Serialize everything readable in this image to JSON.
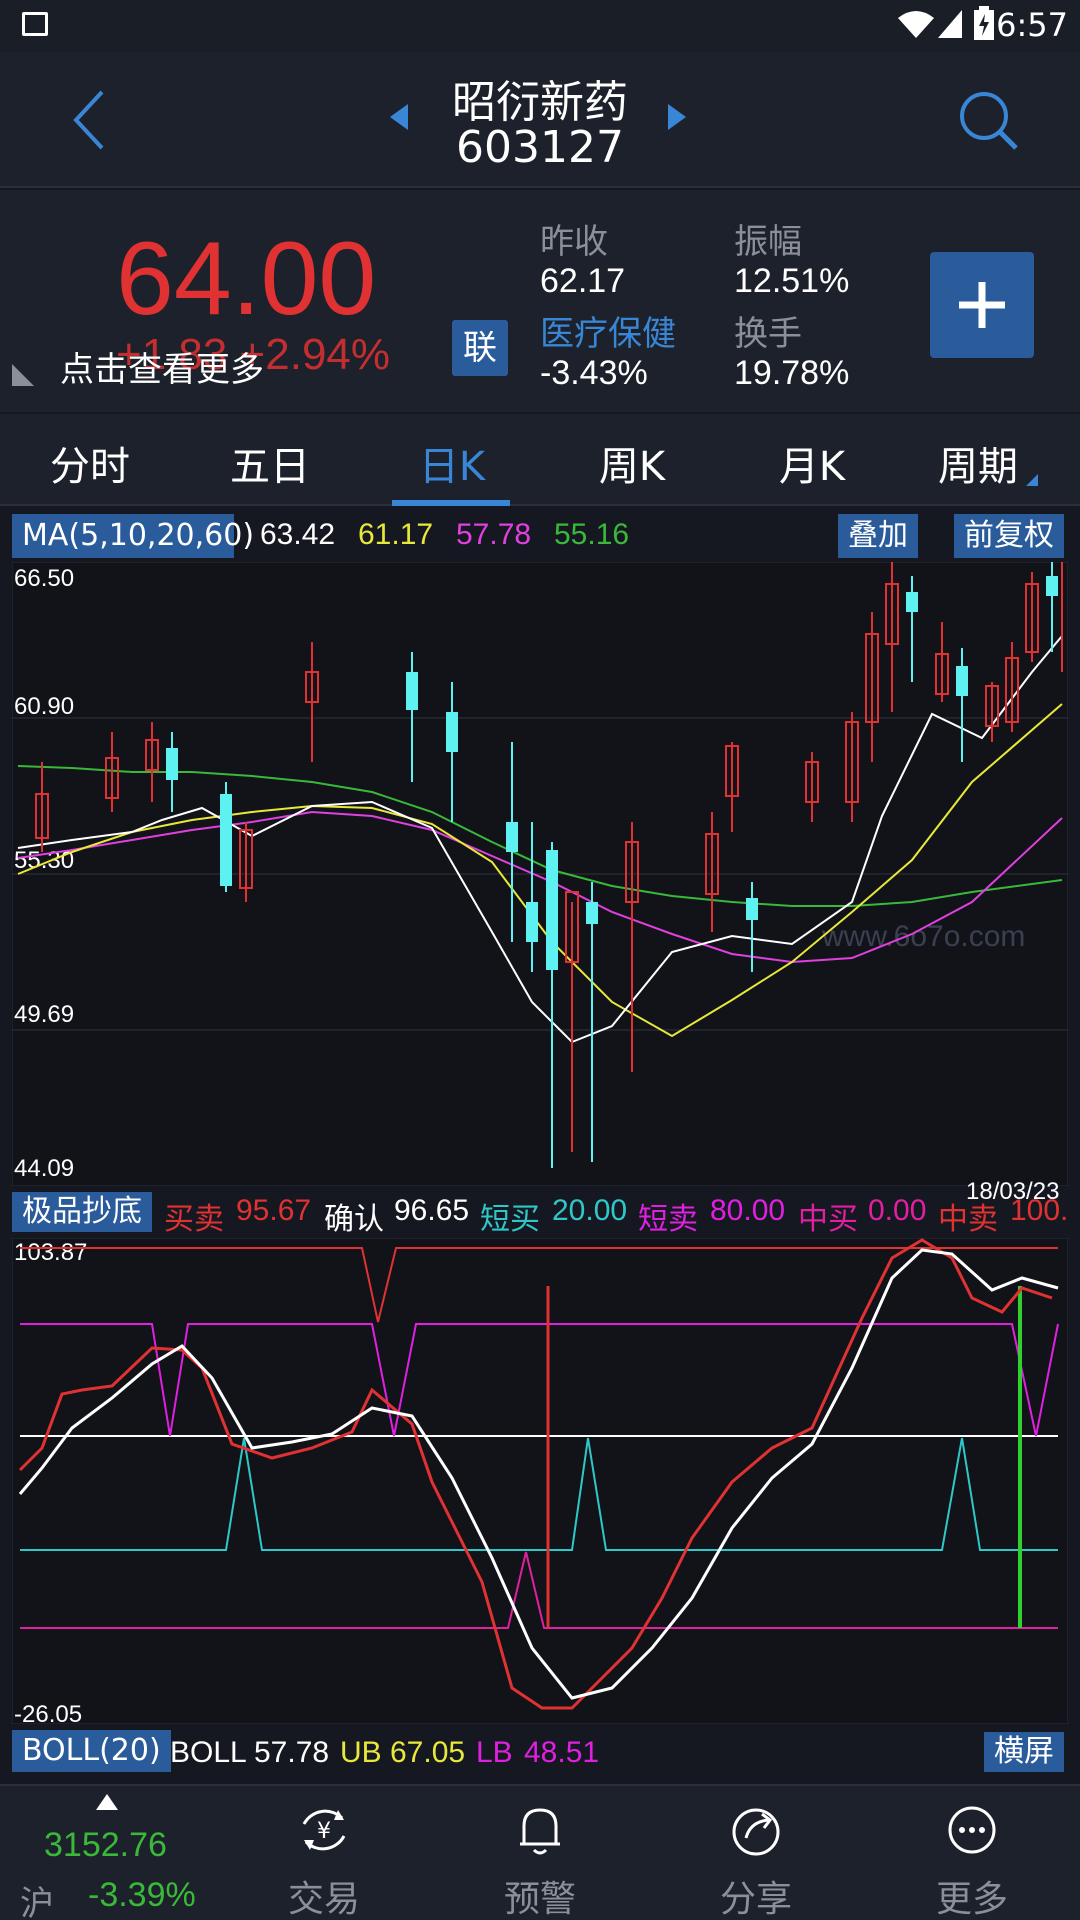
{
  "status": {
    "time": "6:57"
  },
  "header": {
    "stock_name": "昭衍新药",
    "stock_code": "603127"
  },
  "quote": {
    "price": "64.00",
    "change": "+1.83  +2.94%",
    "tooltip": "点击查看更多",
    "lian_label": "联",
    "prev_close_label": "昨收",
    "prev_close": "62.17",
    "amplitude_label": "振幅",
    "amplitude": "12.51%",
    "sector_label": "医疗保健",
    "sector_change": "-3.43%",
    "turnover_label": "换手",
    "turnover": "19.78%",
    "colors": {
      "up": "#e03232",
      "down": "#5ef1f1",
      "accent": "#3a86d6"
    }
  },
  "tabs": [
    "分时",
    "五日",
    "日K",
    "周K",
    "月K",
    "周期"
  ],
  "active_tab": "日K",
  "ma_legend": {
    "label": "MA(5,10,20,60)",
    "ma5": "63.42",
    "ma10": "61.17",
    "ma20": "57.78",
    "ma60": "55.16",
    "overlay_btn": "叠加",
    "adjust_btn": "前复权"
  },
  "kline_axis": {
    "y1": "66.50",
    "y2": "60.90",
    "y3": "55.30",
    "y4": "49.69",
    "y5": "44.09"
  },
  "watermark": "www.6o7o.com",
  "indicator": {
    "label": "极品抄底",
    "buy_sell_label": "买卖",
    "buy_sell": "95.67",
    "confirm_label": "确认",
    "confirm": "96.65",
    "short_buy_label": "短买",
    "short_buy": "20.00",
    "short_sell_label": "短卖",
    "short_sell": "80.00",
    "mid_buy_label": "中买",
    "mid_buy": "0.00",
    "mid_sell_label": "中卖",
    "mid_sell": "100.",
    "date": "18/03/23",
    "y_top": "103.87",
    "y_bottom": "-26.05"
  },
  "boll": {
    "label": "BOLL(20)",
    "boll_label": "BOLL",
    "boll": "57.78",
    "ub_label": "UB",
    "ub": "67.05",
    "lb_label": "LB",
    "lb": "48.51",
    "landscape_btn": "横屏"
  },
  "bottom_nav": {
    "index_value": "3152.76",
    "index_market": "沪",
    "index_change": "-3.39%",
    "trade": "交易",
    "alert": "预警",
    "share": "分享",
    "more": "更多"
  }
}
